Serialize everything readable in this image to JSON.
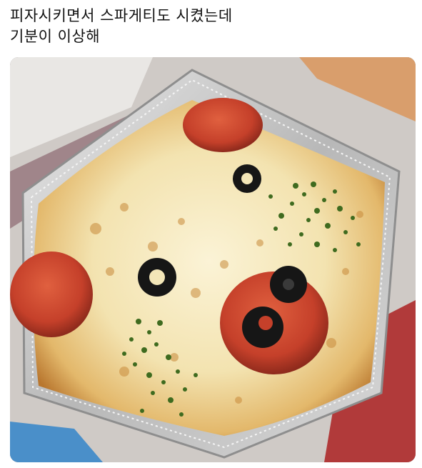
{
  "post": {
    "caption_line1": "피자시키면서 스파게티도 시켰는데",
    "caption_line2": "기분이 이상해"
  },
  "photo": {
    "subject": "cheese-baked spaghetti tray with pepperoni and olive face"
  },
  "colors": {
    "caption_text": "#111111",
    "cheese": "#f3e6b8",
    "pepperoni": "#c9452e",
    "olive": "#161616",
    "parsley": "#3f6b1f",
    "foil": "#c9c9c9",
    "box_red": "#b13a3a"
  }
}
